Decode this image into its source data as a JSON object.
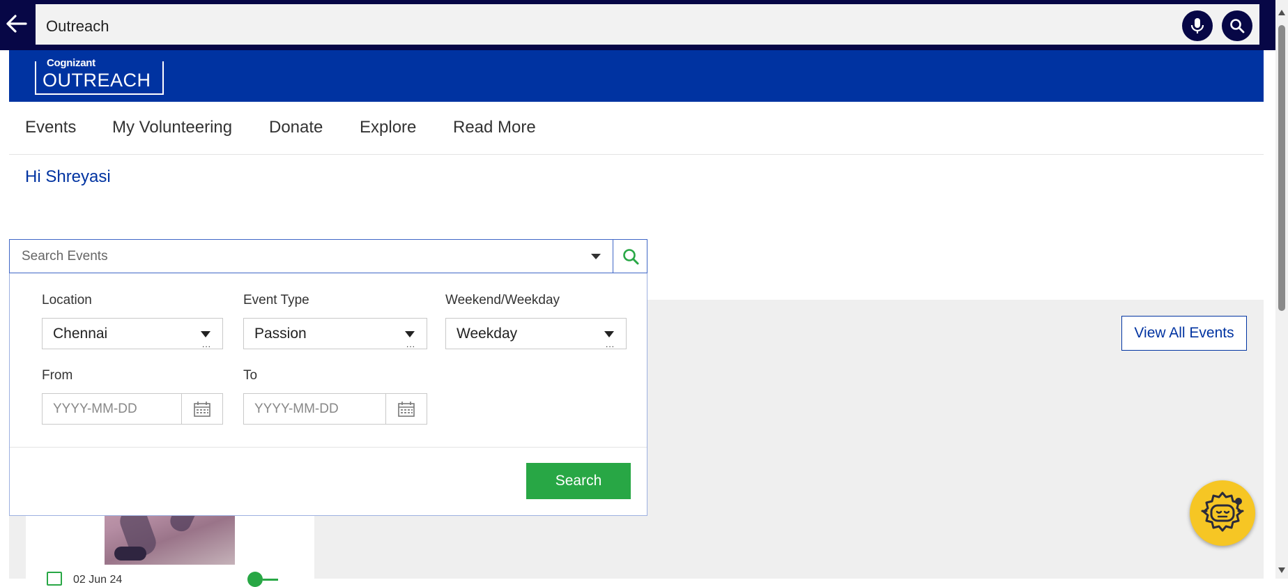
{
  "browser": {
    "search_query": "Outreach",
    "icons": [
      "back-arrow-icon",
      "microphone-icon",
      "search-icon"
    ]
  },
  "brand": {
    "logo_top": "Cognizant",
    "logo_main": "OUTREACH",
    "color": "#0033a1"
  },
  "nav": {
    "items": [
      {
        "label": "Events"
      },
      {
        "label": "My Volunteering"
      },
      {
        "label": "Donate"
      },
      {
        "label": "Explore"
      },
      {
        "label": "Read More"
      }
    ]
  },
  "greeting": "Hi Shreyasi",
  "search": {
    "placeholder": "Search Events",
    "filters": {
      "location": {
        "label": "Location",
        "value": "Chennai"
      },
      "event_type": {
        "label": "Event Type",
        "value": "Passion"
      },
      "weekend": {
        "label": "Weekend/Weekday",
        "value": "Weekday"
      },
      "from": {
        "label": "From",
        "placeholder": "YYYY-MM-DD"
      },
      "to": {
        "label": "To",
        "placeholder": "YYYY-MM-DD"
      }
    },
    "button_label": "Search"
  },
  "view_all_label": "View All Events",
  "card": {
    "date_partial": "02 Jun 24"
  },
  "colors": {
    "accent_green": "#28a745",
    "browser_bar": "#070746",
    "assistant": "#f6c624"
  }
}
